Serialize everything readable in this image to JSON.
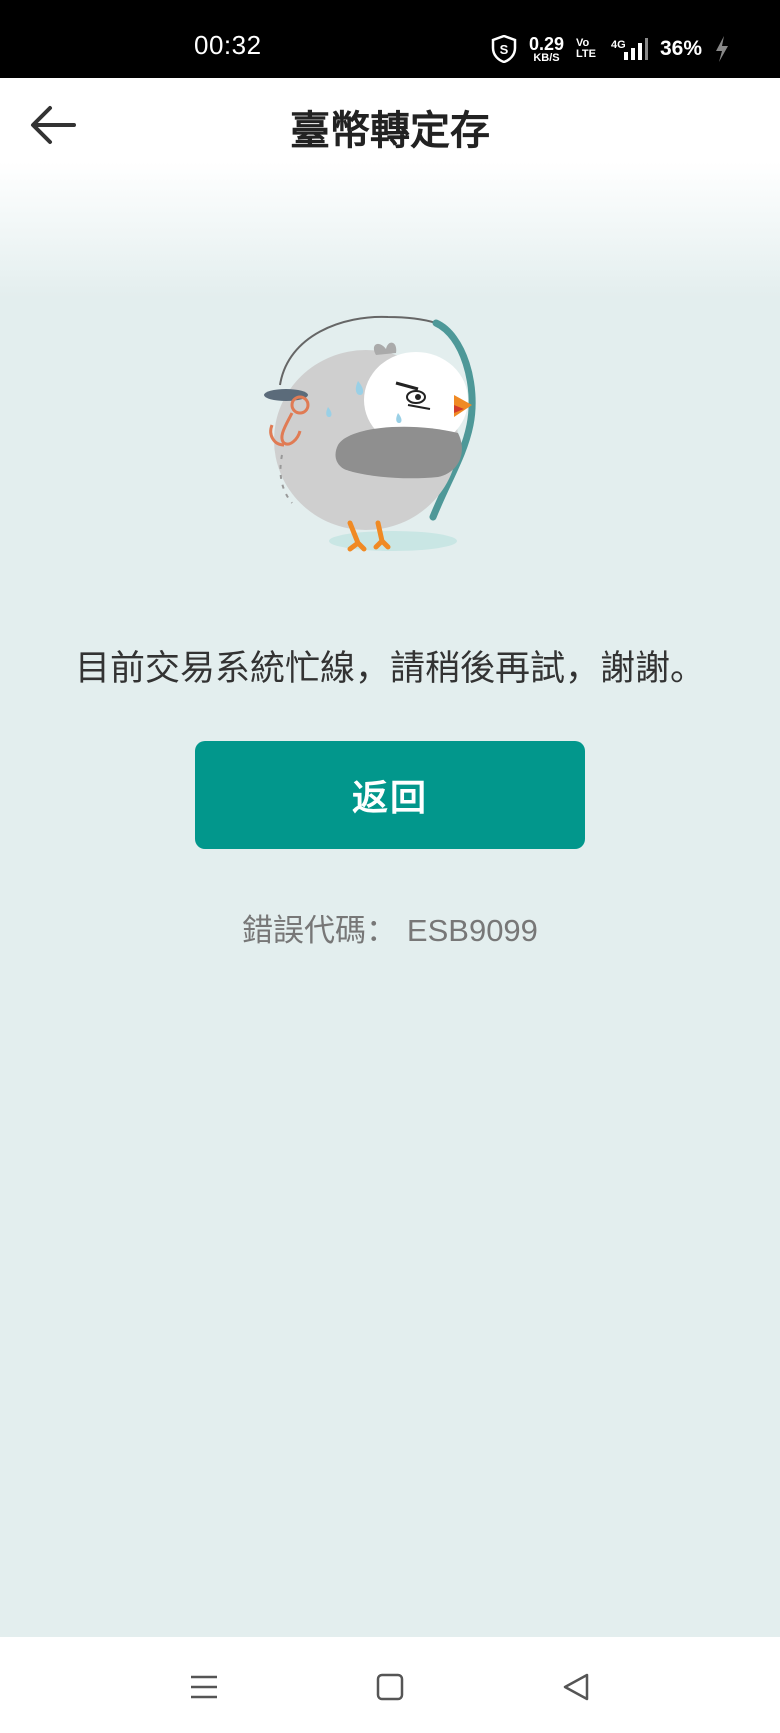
{
  "status_bar": {
    "time": "00:32",
    "net_speed_value": "0.29",
    "net_speed_unit": "KB/S",
    "volte_top": "Vo",
    "volte_bottom": "LTE",
    "network": "4G",
    "battery": "36%"
  },
  "header": {
    "title": "臺幣轉定存"
  },
  "main": {
    "message": "目前交易系統忙線，請稍後再試，謝謝。",
    "return_label": "返回",
    "error_label": "錯誤代碼：",
    "error_code": "ESB9099"
  },
  "colors": {
    "accent": "#02978c",
    "background": "#e3eeee"
  },
  "icons": {
    "back": "arrow-left-icon",
    "nav_menu": "menu-icon",
    "nav_home": "square-home-icon",
    "nav_back": "triangle-back-icon"
  }
}
